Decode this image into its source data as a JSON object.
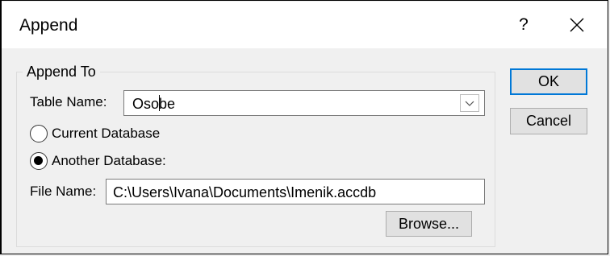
{
  "dialog": {
    "title": "Append",
    "help_label": "?",
    "close_icon": "close-icon"
  },
  "append_to": {
    "legend": "Append To",
    "table_name_label": "Table Name:",
    "table_name_value": "Osobe",
    "current_db_label": "Current Database",
    "another_db_label": "Another Database:",
    "selected_option": "another_database",
    "file_name_label": "File Name:",
    "file_name_value": "C:\\Users\\Ivana\\Documents\\Imenik.accdb"
  },
  "buttons": {
    "ok": "OK",
    "cancel": "Cancel",
    "browse": "Browse..."
  },
  "colors": {
    "focus_border": "#0078d7",
    "dialog_bg": "#f0f0f0"
  }
}
